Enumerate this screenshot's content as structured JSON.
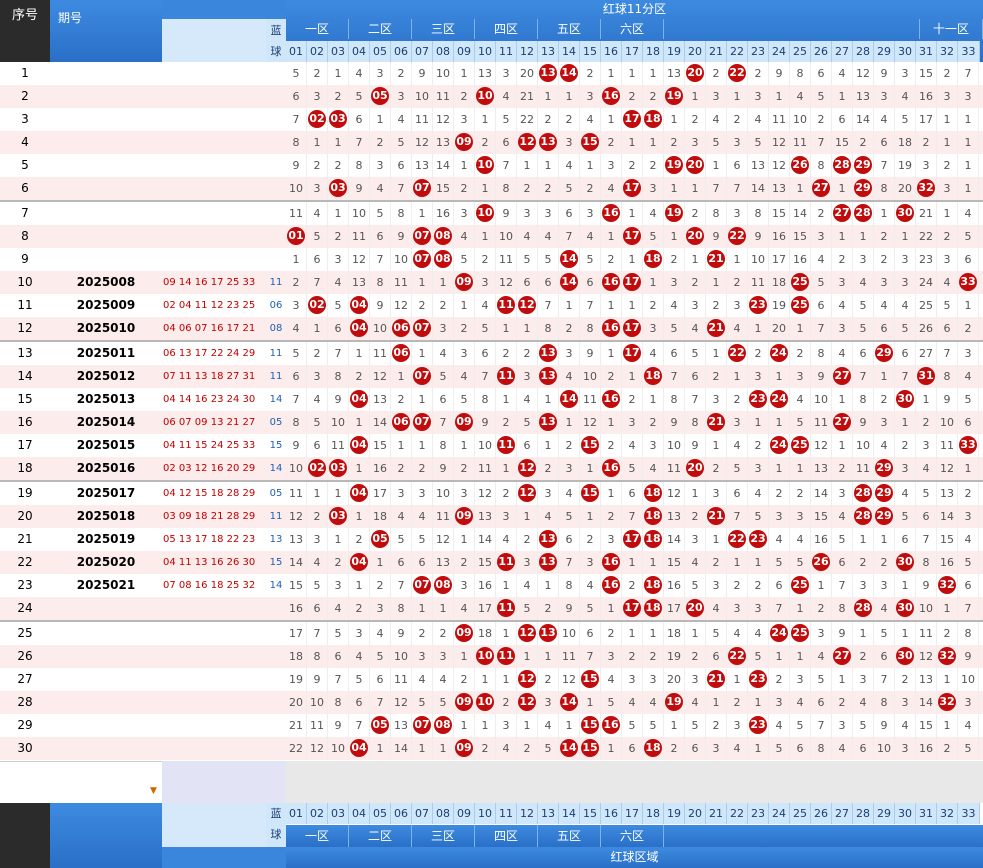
{
  "header": {
    "seq_label": "序号",
    "issue_label": "期号",
    "blue_label": "蓝球",
    "red_title": "红球11分区",
    "zones": [
      "一区",
      "二区",
      "三区",
      "四区",
      "五区",
      "六区",
      "十一区"
    ],
    "numbers": [
      "01",
      "02",
      "03",
      "04",
      "05",
      "06",
      "07",
      "08",
      "09",
      "10",
      "11",
      "12",
      "13",
      "14",
      "15",
      "16",
      "17",
      "18",
      "19",
      "20",
      "21",
      "22",
      "23",
      "24",
      "25",
      "26",
      "27",
      "28",
      "29",
      "30",
      "31",
      "32",
      "33"
    ]
  },
  "footer": {
    "blue_label": "蓝球",
    "red_title": "红球区域",
    "zones": [
      "一区",
      "二区",
      "三区",
      "四区",
      "五区",
      "六区"
    ]
  },
  "rows": [
    {
      "seq": "1",
      "issue": "",
      "draw": "",
      "blue": "",
      "miss": [
        5,
        2,
        1,
        4,
        3,
        2,
        9,
        10,
        1,
        13,
        3,
        20,
        "13",
        "14",
        2,
        1,
        1,
        1,
        13,
        "20",
        2,
        "22",
        2,
        9,
        8,
        6,
        4,
        12,
        9,
        3,
        15,
        2,
        7
      ]
    },
    {
      "seq": "2",
      "issue": "",
      "draw": "",
      "blue": "",
      "miss": [
        6,
        3,
        2,
        5,
        "05",
        3,
        10,
        11,
        2,
        "10",
        4,
        21,
        1,
        1,
        3,
        "16",
        2,
        2,
        "19",
        1,
        3,
        1,
        3,
        1,
        4,
        5,
        1,
        13,
        3,
        4,
        16,
        3,
        3
      ]
    },
    {
      "seq": "3",
      "issue": "",
      "draw": "",
      "blue": "",
      "miss": [
        7,
        "02",
        "03",
        6,
        1,
        4,
        11,
        12,
        3,
        1,
        5,
        22,
        2,
        2,
        4,
        1,
        "17",
        "18",
        1,
        2,
        4,
        2,
        4,
        11,
        10,
        2,
        6,
        14,
        4,
        5,
        17,
        1,
        1
      ]
    },
    {
      "seq": "4",
      "issue": "",
      "draw": "",
      "blue": "",
      "miss": [
        8,
        1,
        1,
        7,
        2,
        5,
        12,
        13,
        "09",
        2,
        6,
        "12",
        "13",
        3,
        "15",
        2,
        1,
        1,
        2,
        3,
        5,
        3,
        5,
        12,
        11,
        7,
        15,
        2,
        6,
        18,
        2,
        1,
        1
      ]
    },
    {
      "seq": "5",
      "issue": "",
      "draw": "",
      "blue": "",
      "miss": [
        9,
        2,
        2,
        8,
        3,
        6,
        13,
        14,
        1,
        "10",
        7,
        1,
        1,
        4,
        1,
        3,
        2,
        2,
        "19",
        "20",
        1,
        6,
        13,
        12,
        "26",
        8,
        "28",
        "29",
        7,
        19,
        3,
        2,
        1
      ]
    },
    {
      "seq": "6",
      "issue": "",
      "draw": "",
      "blue": "",
      "miss": [
        10,
        3,
        "03",
        9,
        4,
        7,
        "07",
        15,
        2,
        1,
        8,
        2,
        2,
        5,
        2,
        4,
        "17",
        3,
        1,
        1,
        7,
        7,
        14,
        13,
        1,
        "27",
        1,
        "29",
        8,
        20,
        "32",
        3,
        1
      ]
    },
    {
      "seq": "7",
      "issue": "",
      "draw": "",
      "blue": "",
      "miss": [
        11,
        4,
        1,
        10,
        5,
        8,
        1,
        16,
        3,
        "10",
        9,
        3,
        3,
        6,
        3,
        "16",
        1,
        4,
        "19",
        2,
        8,
        3,
        8,
        15,
        14,
        2,
        "27",
        "28",
        1,
        "30",
        21,
        1,
        4
      ]
    },
    {
      "seq": "8",
      "issue": "",
      "draw": "",
      "blue": "",
      "miss": [
        "01",
        5,
        2,
        11,
        6,
        9,
        "07",
        "08",
        4,
        1,
        10,
        4,
        4,
        7,
        4,
        1,
        "17",
        5,
        1,
        "20",
        9,
        "22",
        9,
        16,
        15,
        3,
        1,
        1,
        2,
        1,
        22,
        2,
        5
      ]
    },
    {
      "seq": "9",
      "issue": "",
      "draw": "",
      "blue": "",
      "miss": [
        1,
        6,
        3,
        12,
        7,
        10,
        "07",
        "08",
        5,
        2,
        11,
        5,
        5,
        "14",
        5,
        2,
        1,
        "18",
        2,
        1,
        "21",
        1,
        10,
        17,
        16,
        4,
        2,
        3,
        2,
        3,
        23,
        3,
        6
      ]
    },
    {
      "seq": "10",
      "issue": "2025008",
      "draw": "09 14 16 17 25 33",
      "blue": "11",
      "miss": [
        2,
        7,
        4,
        13,
        8,
        11,
        1,
        1,
        "09",
        3,
        12,
        6,
        6,
        "14",
        6,
        "16",
        "17",
        1,
        3,
        2,
        1,
        2,
        11,
        18,
        "25",
        5,
        3,
        4,
        3,
        3,
        24,
        4,
        "33"
      ]
    },
    {
      "seq": "11",
      "issue": "2025009",
      "draw": "02 04 11 12 23 25",
      "blue": "06",
      "miss": [
        3,
        "02",
        5,
        "04",
        9,
        12,
        2,
        2,
        1,
        4,
        "11",
        "12",
        7,
        1,
        7,
        1,
        1,
        2,
        4,
        3,
        2,
        3,
        "23",
        19,
        "25",
        6,
        4,
        5,
        4,
        4,
        25,
        5,
        1
      ]
    },
    {
      "seq": "12",
      "issue": "2025010",
      "draw": "04 06 07 16 17 21",
      "blue": "08",
      "miss": [
        4,
        1,
        6,
        "04",
        10,
        "06",
        "07",
        3,
        2,
        5,
        1,
        1,
        8,
        2,
        8,
        "16",
        "17",
        3,
        5,
        4,
        "21",
        4,
        1,
        20,
        1,
        7,
        3,
        5,
        6,
        5,
        26,
        6,
        2
      ]
    },
    {
      "seq": "13",
      "issue": "2025011",
      "draw": "06 13 17 22 24 29",
      "blue": "11",
      "miss": [
        5,
        2,
        7,
        1,
        11,
        "06",
        1,
        4,
        3,
        6,
        2,
        2,
        "13",
        3,
        9,
        1,
        "17",
        4,
        6,
        5,
        1,
        "22",
        2,
        "24",
        2,
        8,
        4,
        6,
        "29",
        6,
        27,
        7,
        3
      ]
    },
    {
      "seq": "14",
      "issue": "2025012",
      "draw": "07 11 13 18 27 31",
      "blue": "11",
      "miss": [
        6,
        3,
        8,
        2,
        12,
        1,
        "07",
        5,
        4,
        7,
        "11",
        3,
        "13",
        4,
        10,
        2,
        1,
        "18",
        7,
        6,
        2,
        1,
        3,
        1,
        3,
        9,
        "27",
        7,
        1,
        7,
        "31",
        8,
        4
      ]
    },
    {
      "seq": "15",
      "issue": "2025013",
      "draw": "04 14 16 23 24 30",
      "blue": "14",
      "miss": [
        7,
        4,
        9,
        "04",
        13,
        2,
        1,
        6,
        5,
        8,
        1,
        4,
        1,
        "14",
        11,
        "16",
        2,
        1,
        8,
        7,
        3,
        2,
        "23",
        "24",
        4,
        10,
        1,
        8,
        2,
        "30",
        1,
        9,
        5
      ]
    },
    {
      "seq": "16",
      "issue": "2025014",
      "draw": "06 07 09 13 21 27",
      "blue": "05",
      "miss": [
        8,
        5,
        10,
        1,
        14,
        "06",
        "07",
        7,
        "09",
        9,
        2,
        5,
        "13",
        1,
        12,
        1,
        3,
        2,
        9,
        8,
        "21",
        3,
        1,
        1,
        5,
        11,
        "27",
        9,
        3,
        1,
        2,
        10,
        6
      ]
    },
    {
      "seq": "17",
      "issue": "2025015",
      "draw": "04 11 15 24 25 33",
      "blue": "15",
      "miss": [
        9,
        6,
        11,
        "04",
        15,
        1,
        1,
        8,
        1,
        10,
        "11",
        6,
        1,
        2,
        "15",
        2,
        4,
        3,
        10,
        9,
        1,
        4,
        2,
        "24",
        "25",
        12,
        1,
        10,
        4,
        2,
        3,
        11,
        "33"
      ]
    },
    {
      "seq": "18",
      "issue": "2025016",
      "draw": "02 03 12 16 20 29",
      "blue": "14",
      "miss": [
        10,
        "02",
        "03",
        1,
        16,
        2,
        2,
        9,
        2,
        11,
        1,
        "12",
        2,
        3,
        1,
        "16",
        5,
        4,
        11,
        "20",
        2,
        5,
        3,
        1,
        1,
        13,
        2,
        11,
        "29",
        3,
        4,
        12,
        1
      ]
    },
    {
      "seq": "19",
      "issue": "2025017",
      "draw": "04 12 15 18 28 29",
      "blue": "05",
      "miss": [
        11,
        1,
        1,
        "04",
        17,
        3,
        3,
        10,
        3,
        12,
        2,
        "12",
        3,
        4,
        "15",
        1,
        6,
        "18",
        12,
        1,
        3,
        6,
        4,
        2,
        2,
        14,
        3,
        "28",
        "29",
        4,
        5,
        13,
        2
      ]
    },
    {
      "seq": "20",
      "issue": "2025018",
      "draw": "03 09 18 21 28 29",
      "blue": "11",
      "miss": [
        12,
        2,
        "03",
        1,
        18,
        4,
        4,
        11,
        "09",
        13,
        3,
        1,
        4,
        5,
        1,
        2,
        7,
        "18",
        13,
        2,
        "21",
        7,
        5,
        3,
        3,
        15,
        4,
        "28",
        "29",
        5,
        6,
        14,
        3
      ]
    },
    {
      "seq": "21",
      "issue": "2025019",
      "draw": "05 13 17 18 22 23",
      "blue": "13",
      "miss": [
        13,
        3,
        1,
        2,
        "05",
        5,
        5,
        12,
        1,
        14,
        4,
        2,
        "13",
        6,
        2,
        3,
        "17",
        "18",
        14,
        3,
        1,
        "22",
        "23",
        4,
        4,
        16,
        5,
        1,
        1,
        6,
        7,
        15,
        4
      ]
    },
    {
      "seq": "22",
      "issue": "2025020",
      "draw": "04 11 13 16 26 30",
      "blue": "15",
      "miss": [
        14,
        4,
        2,
        "04",
        1,
        6,
        6,
        13,
        2,
        15,
        "11",
        3,
        "13",
        7,
        3,
        "16",
        1,
        1,
        15,
        4,
        2,
        1,
        1,
        5,
        5,
        "26",
        6,
        2,
        2,
        "30",
        8,
        16,
        5
      ]
    },
    {
      "seq": "23",
      "issue": "2025021",
      "draw": "07 08 16 18 25 32",
      "blue": "14",
      "miss": [
        15,
        5,
        3,
        1,
        2,
        7,
        "07",
        "08",
        3,
        16,
        1,
        4,
        1,
        8,
        4,
        "16",
        2,
        "18",
        16,
        5,
        3,
        2,
        2,
        6,
        "25",
        1,
        7,
        3,
        3,
        1,
        9,
        "32",
        6
      ]
    },
    {
      "seq": "24",
      "issue": "",
      "draw": "",
      "blue": "",
      "miss": [
        16,
        6,
        4,
        2,
        3,
        8,
        1,
        1,
        4,
        17,
        "11",
        5,
        2,
        9,
        5,
        1,
        "17",
        "18",
        17,
        "20",
        4,
        3,
        3,
        7,
        1,
        2,
        8,
        "28",
        4,
        "30",
        10,
        1,
        7
      ]
    },
    {
      "seq": "25",
      "issue": "",
      "draw": "",
      "blue": "",
      "miss": [
        17,
        7,
        5,
        3,
        4,
        9,
        2,
        2,
        "09",
        18,
        1,
        "12",
        "13",
        10,
        6,
        2,
        1,
        1,
        18,
        1,
        5,
        4,
        4,
        "24",
        "25",
        3,
        9,
        1,
        5,
        1,
        11,
        2,
        8
      ]
    },
    {
      "seq": "26",
      "issue": "",
      "draw": "",
      "blue": "",
      "miss": [
        18,
        8,
        6,
        4,
        5,
        10,
        3,
        3,
        1,
        "10",
        "11",
        1,
        1,
        11,
        7,
        3,
        2,
        2,
        19,
        2,
        6,
        "22",
        5,
        1,
        1,
        4,
        "27",
        2,
        6,
        "30",
        12,
        "32",
        9
      ]
    },
    {
      "seq": "27",
      "issue": "",
      "draw": "",
      "blue": "",
      "miss": [
        19,
        9,
        7,
        5,
        6,
        11,
        4,
        4,
        2,
        1,
        1,
        "12",
        2,
        12,
        "15",
        4,
        3,
        3,
        20,
        3,
        "21",
        1,
        "23",
        2,
        3,
        5,
        1,
        3,
        7,
        2,
        13,
        1,
        10
      ]
    },
    {
      "seq": "28",
      "issue": "",
      "draw": "",
      "blue": "",
      "miss": [
        20,
        10,
        8,
        6,
        7,
        12,
        5,
        5,
        "09",
        "10",
        2,
        "12",
        3,
        "14",
        1,
        5,
        4,
        4,
        "19",
        4,
        1,
        2,
        1,
        3,
        4,
        6,
        2,
        4,
        8,
        3,
        14,
        "32",
        3
      ]
    },
    {
      "seq": "29",
      "issue": "",
      "draw": "",
      "blue": "",
      "miss": [
        21,
        11,
        9,
        7,
        "05",
        13,
        "07",
        "08",
        1,
        1,
        3,
        1,
        4,
        1,
        "15",
        "16",
        5,
        5,
        1,
        5,
        2,
        3,
        "23",
        4,
        5,
        7,
        3,
        5,
        9,
        4,
        15,
        1,
        4
      ]
    },
    {
      "seq": "30",
      "issue": "",
      "draw": "",
      "blue": "",
      "miss": [
        22,
        12,
        10,
        "04",
        1,
        14,
        1,
        1,
        "09",
        2,
        4,
        2,
        5,
        "14",
        "15",
        1,
        6,
        "18",
        2,
        6,
        3,
        4,
        1,
        5,
        6,
        8,
        4,
        6,
        10,
        3,
        16,
        2,
        5
      ]
    }
  ],
  "colors": {
    "ball": "#c00c0c",
    "header_blue": "#2f7ad3",
    "row_pink": "#fdecec",
    "draw_red": "#c30000",
    "blue_ball": "#1f5fb3"
  }
}
